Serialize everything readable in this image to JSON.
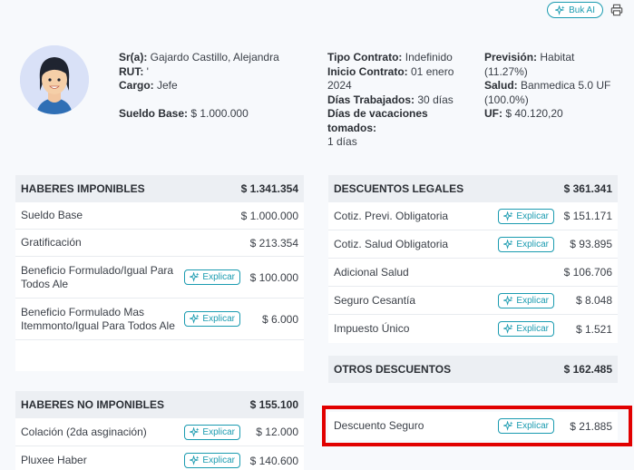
{
  "topbar": {
    "ai_label": "Buk AI"
  },
  "employee": {
    "name_label": "Sr(a):",
    "name": " Gajardo Castillo, Alejandra",
    "rut_label": "RUT:",
    "rut": " '",
    "cargo_label": "Cargo:",
    "cargo": " Jefe",
    "sueldo_label": "Sueldo Base:",
    "sueldo": " $ 1.000.000"
  },
  "contract": {
    "tipo_label": "Tipo Contrato:",
    "tipo": " Indefinido",
    "inicio_label": "Inicio Contrato:",
    "inicio_a": " 01 enero",
    "inicio_b": "2024",
    "dias_label": "Días Trabajados:",
    "dias": " 30 días",
    "vac_label": "Días de vacaciones tomados:",
    "vac": "1 días"
  },
  "prevision": {
    "prev_label": "Previsión:",
    "prev": " Habitat (11.27%)",
    "salud_label": "Salud:",
    "salud_a": " Banmedica 5.0 UF",
    "salud_b": "(100.0%)",
    "uf_label": "UF:",
    "uf": " $ 40.120,20"
  },
  "explicar_label": "Explicar",
  "haberes_imponibles": {
    "title": "HABERES IMPONIBLES",
    "total": "$ 1.341.354",
    "rows": [
      {
        "label": "Sueldo Base",
        "amount": "$ 1.000.000"
      },
      {
        "label": "Gratificación",
        "amount": "$ 213.354"
      },
      {
        "label": "Beneficio Formulado/Igual Para Todos Ale",
        "amount": "$ 100.000"
      },
      {
        "label": "Beneficio Formulado Mas Itemmonto/Igual Para Todos Ale",
        "amount": "$ 6.000"
      }
    ]
  },
  "haberes_no_imponibles": {
    "title": "HABERES NO IMPONIBLES",
    "total": "$ 155.100",
    "rows": [
      {
        "label": "Colación (2da asginación)",
        "amount": "$ 12.000"
      },
      {
        "label": "Pluxee Haber",
        "amount": "$ 140.600"
      }
    ]
  },
  "descuentos_legales": {
    "title": "DESCUENTOS LEGALES",
    "total": "$ 361.341",
    "rows": [
      {
        "label": "Cotiz. Previ. Obligatoria",
        "amount": "$ 151.171"
      },
      {
        "label": "Cotiz. Salud Obligatoria",
        "amount": "$ 93.895"
      },
      {
        "label": "Adicional Salud",
        "amount": "$ 106.706"
      },
      {
        "label": "Seguro Cesantía",
        "amount": "$ 8.048"
      },
      {
        "label": "Impuesto Único",
        "amount": "$ 1.521"
      }
    ]
  },
  "otros_descuentos": {
    "title": "OTROS DESCUENTOS",
    "total": "$ 162.485",
    "rows": [
      {
        "label": "Descuento Seguro",
        "amount": "$ 21.885"
      }
    ]
  },
  "colors": {
    "accent": "#1a9bb0",
    "highlight": "#e10000"
  }
}
